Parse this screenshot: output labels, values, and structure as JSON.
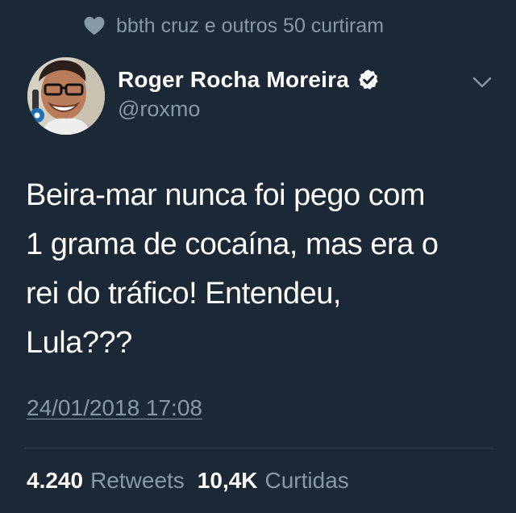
{
  "social_context": {
    "icon": "heart-icon",
    "text": "bbth cruz e outros 50 curtiram"
  },
  "author": {
    "display_name": "Roger Rocha Moreira",
    "handle": "@roxmo",
    "verified": true,
    "verified_icon": "verified-badge-icon"
  },
  "menu_icon": "chevron-down-icon",
  "tweet": {
    "text": "Beira-mar nunca foi pego com\n1 grama de cocaína, mas era o\nrei do tráfico! Entendeu,\nLula???",
    "timestamp": "24/01/2018 17:08"
  },
  "stats": {
    "retweets_count": "4.240",
    "retweets_label": "Retweets",
    "likes_count": "10,4K",
    "likes_label": "Curtidas"
  },
  "colors": {
    "background": "#1b2836",
    "primary_text": "#ffffff",
    "secondary_text": "#8899a6",
    "divider": "#38444d"
  }
}
